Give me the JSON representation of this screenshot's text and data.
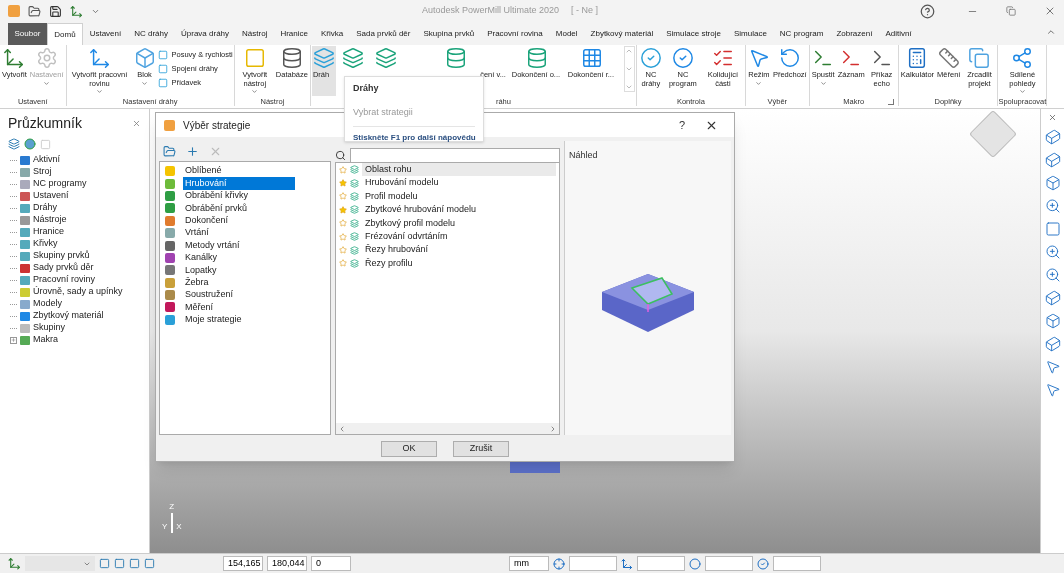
{
  "window": {
    "title": "Autodesk PowerMill Ultimate 2020",
    "document": "[ - Ne ]"
  },
  "tabs": [
    {
      "label": "Soubor",
      "kind": "file",
      "selected": false
    },
    {
      "label": "Domů",
      "kind": "tab",
      "selected": true
    },
    {
      "label": "Ustavení",
      "kind": "tab",
      "selected": false
    },
    {
      "label": "NC dráhy",
      "kind": "tab",
      "selected": false
    },
    {
      "label": "Úprava dráhy",
      "kind": "tab",
      "selected": false
    },
    {
      "label": "Nástroj",
      "kind": "tab",
      "selected": false
    },
    {
      "label": "Hranice",
      "kind": "tab",
      "selected": false
    },
    {
      "label": "Křivka",
      "kind": "tab",
      "selected": false
    },
    {
      "label": "Sada prvků děr",
      "kind": "tab",
      "selected": false
    },
    {
      "label": "Skupina prvků",
      "kind": "tab",
      "selected": false
    },
    {
      "label": "Pracovní rovina",
      "kind": "tab",
      "selected": false
    },
    {
      "label": "Model",
      "kind": "tab",
      "selected": false
    },
    {
      "label": "Zbytkový materiál",
      "kind": "tab",
      "selected": false
    },
    {
      "label": "Simulace stroje",
      "kind": "tab",
      "selected": false
    },
    {
      "label": "Simulace",
      "kind": "tab",
      "selected": false
    },
    {
      "label": "NC program",
      "kind": "tab",
      "selected": false
    },
    {
      "label": "Zobrazení",
      "kind": "tab",
      "selected": false
    },
    {
      "label": "Aditivní",
      "kind": "tab",
      "selected": false
    }
  ],
  "ribbon": [
    {
      "label": "Ustavení",
      "launcher": false,
      "buttons": [
        {
          "label": "Vytvořit",
          "kind": "large",
          "disabled": false,
          "dropdown": false
        },
        {
          "label": "Nastavení",
          "kind": "large",
          "disabled": true,
          "dropdown": true
        }
      ]
    },
    {
      "label": "Nastavení dráhy",
      "launcher": false,
      "buttons": [
        {
          "label": "Vytvořit pracovní rovinu",
          "kind": "large",
          "disabled": false,
          "dropdown": true
        },
        {
          "label": "Blok",
          "kind": "large",
          "disabled": false,
          "dropdown": true
        },
        {
          "label": "Posuvy & rychlosti",
          "kind": "small",
          "disabled": false,
          "dropdown": false
        },
        {
          "label": "Spojení dráhy",
          "kind": "small",
          "disabled": false,
          "dropdown": false
        },
        {
          "label": "Přídavek",
          "kind": "small",
          "disabled": false,
          "dropdown": false
        }
      ]
    },
    {
      "label": "Nástroj",
      "launcher": false,
      "buttons": [
        {
          "label": "Vytvořit nástroj",
          "kind": "large",
          "disabled": false,
          "dropdown": true
        },
        {
          "label": "Databáze",
          "kind": "large",
          "disabled": false,
          "dropdown": false
        }
      ]
    },
    {
      "label": "ráhu",
      "launcher": false,
      "buttons": [
        {
          "label": "Dráh",
          "kind": "gallery",
          "disabled": false,
          "dropdown": false
        },
        {
          "kind": "gallery",
          "disabled": false,
          "dropdown": false
        },
        {
          "kind": "gallery",
          "disabled": false,
          "dropdown": false
        },
        {
          "label": "čení v...",
          "kind": "gallery",
          "disabled": false,
          "dropdown": false
        },
        {
          "label": "Dokončení o...",
          "kind": "gallery",
          "disabled": false,
          "dropdown": false
        },
        {
          "label": "Dokončení r...",
          "kind": "gallery",
          "disabled": false,
          "dropdown": false
        }
      ]
    },
    {
      "label": "Kontrola",
      "launcher": false,
      "buttons": [
        {
          "label": "NC dráhy",
          "kind": "large",
          "disabled": false,
          "dropdown": false
        },
        {
          "label": "NC program",
          "kind": "large",
          "disabled": false,
          "dropdown": false
        },
        {
          "label": "Kolidující části",
          "kind": "large",
          "disabled": false,
          "dropdown": false
        }
      ]
    },
    {
      "label": "Výběr",
      "launcher": false,
      "buttons": [
        {
          "label": "Režim",
          "kind": "large",
          "disabled": false,
          "dropdown": true
        },
        {
          "label": "Předchozí",
          "kind": "large",
          "disabled": false,
          "dropdown": false
        }
      ]
    },
    {
      "label": "Makro",
      "launcher": true,
      "buttons": [
        {
          "label": "Spustit",
          "kind": "large",
          "disabled": false,
          "dropdown": true
        },
        {
          "label": "Záznam",
          "kind": "large",
          "disabled": false,
          "dropdown": false
        },
        {
          "label": "Příkaz echo",
          "kind": "large",
          "disabled": false,
          "dropdown": false
        }
      ]
    },
    {
      "label": "Doplňky",
      "launcher": false,
      "buttons": [
        {
          "label": "Kalkulátor",
          "kind": "large",
          "disabled": false,
          "dropdown": false
        },
        {
          "label": "Měření",
          "kind": "large",
          "disabled": false,
          "dropdown": false
        },
        {
          "label": "Zrcadlit projekt",
          "kind": "large",
          "disabled": false,
          "dropdown": false
        }
      ]
    },
    {
      "label": "Spolupracovat",
      "launcher": false,
      "buttons": [
        {
          "label": "Sdílené pohledy",
          "kind": "large",
          "disabled": false,
          "dropdown": true
        }
      ]
    }
  ],
  "explorer": {
    "title": "Průzkumník",
    "items": [
      {
        "label": "Aktivní",
        "kind": "leaf"
      },
      {
        "label": "Stroj",
        "kind": "leaf"
      },
      {
        "label": "NC programy",
        "kind": "leaf"
      },
      {
        "label": "Ustavení",
        "kind": "leaf"
      },
      {
        "label": "Dráhy",
        "kind": "leaf"
      },
      {
        "label": "Nástroje",
        "kind": "leaf"
      },
      {
        "label": "Hranice",
        "kind": "leaf"
      },
      {
        "label": "Křivky",
        "kind": "leaf"
      },
      {
        "label": "Skupiny prvků",
        "kind": "leaf"
      },
      {
        "label": "Sady prvků děr",
        "kind": "leaf"
      },
      {
        "label": "Pracovní roviny",
        "kind": "leaf"
      },
      {
        "label": "Úrovně, sady a upínky",
        "kind": "leaf"
      },
      {
        "label": "Modely",
        "kind": "leaf"
      },
      {
        "label": "Zbytkový materiál",
        "kind": "leaf"
      },
      {
        "label": "Skupiny",
        "kind": "leaf"
      },
      {
        "label": "Makra",
        "kind": "collapsed"
      }
    ]
  },
  "dialog": {
    "title": "Výběr strategie",
    "help": "?",
    "categories": [
      {
        "label": "Oblíbené",
        "selected": false
      },
      {
        "label": "Hrubování",
        "selected": true
      },
      {
        "label": "Obrábění křivky",
        "selected": false
      },
      {
        "label": "Obrábění prvků",
        "selected": false
      },
      {
        "label": "Dokončení",
        "selected": false
      },
      {
        "label": "Vrtání",
        "selected": false
      },
      {
        "label": "Metody vrtání",
        "selected": false
      },
      {
        "label": "Kanálky",
        "selected": false
      },
      {
        "label": "Lopatky",
        "selected": false
      },
      {
        "label": "Žebra",
        "selected": false
      },
      {
        "label": "Soustružení",
        "selected": false
      },
      {
        "label": "Měření",
        "selected": false
      },
      {
        "label": "Moje strategie",
        "selected": false
      }
    ],
    "strategies": [
      {
        "label": "Oblast rohu",
        "favorite": false,
        "selected": true
      },
      {
        "label": "Hrubování modelu",
        "favorite": true,
        "selected": false
      },
      {
        "label": "Profil modelu",
        "favorite": false,
        "selected": false
      },
      {
        "label": "Zbytkové hrubování modelu",
        "favorite": true,
        "selected": false
      },
      {
        "label": "Zbytkový profil modelu",
        "favorite": false,
        "selected": false
      },
      {
        "label": "Frézování odvrtáním",
        "favorite": false,
        "selected": false
      },
      {
        "label": "Řezy hrubování",
        "favorite": false,
        "selected": false
      },
      {
        "label": "Řezy profilu",
        "favorite": false,
        "selected": false
      }
    ],
    "preview_label": "Náhled",
    "buttons": [
      "OK",
      "Zrušit"
    ]
  },
  "tooltip": {
    "title": "Dráhy",
    "description": "Vybrat strategii",
    "help": "Stiskněte F1 pro další nápovědu"
  },
  "axes": [
    "Z",
    "Y",
    "X"
  ],
  "status_bar": {
    "fields": [
      "154,165",
      "180,044",
      "0"
    ],
    "unit": "mm"
  }
}
